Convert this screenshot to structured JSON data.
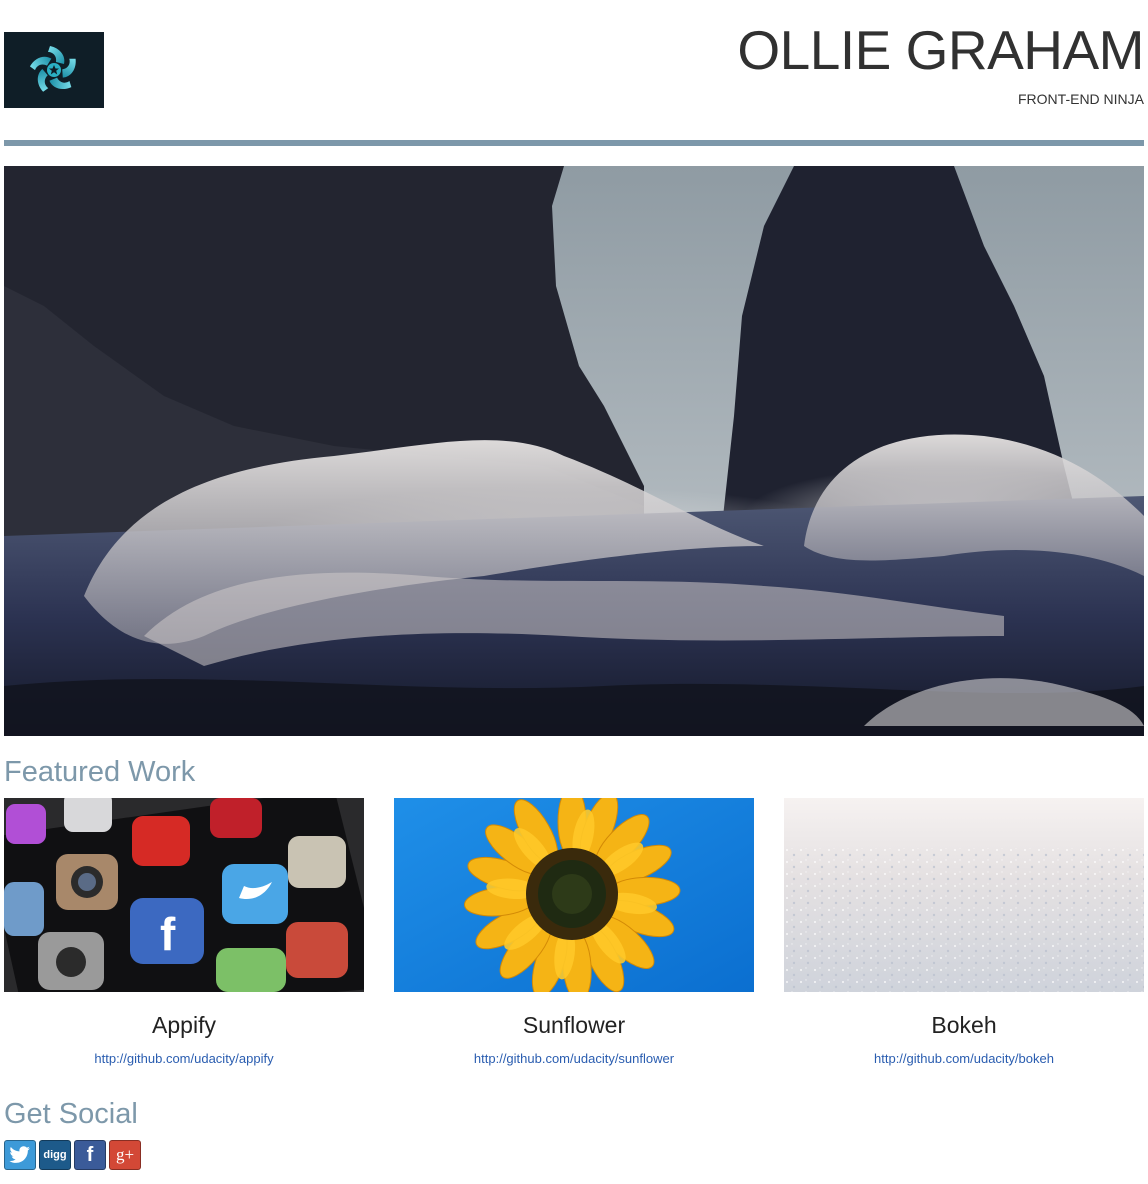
{
  "header": {
    "logo_icon": "star-knot-logo",
    "name": "OLLIE GRAHAM",
    "tagline": "FRONT-END NINJA"
  },
  "hero": {
    "image": "ocean-waves-sea-stacks"
  },
  "featured": {
    "title": "Featured Work",
    "projects": [
      {
        "title": "Appify",
        "link": "http://github.com/udacity/appify",
        "image": "smartphone-app-icons"
      },
      {
        "title": "Sunflower",
        "link": "http://github.com/udacity/sunflower",
        "image": "sunflower-blue-sky"
      },
      {
        "title": "Bokeh",
        "link": "http://github.com/udacity/bokeh",
        "image": "sparkling-snow"
      }
    ]
  },
  "social": {
    "title": "Get Social",
    "buttons": [
      {
        "icon": "twitter-icon",
        "color": "#3d9ad8"
      },
      {
        "icon": "digg-icon",
        "label": "digg",
        "color": "#1d5a8a"
      },
      {
        "icon": "facebook-icon",
        "label": "f",
        "color": "#3b5b99"
      },
      {
        "icon": "google-plus-icon",
        "label": "g+",
        "color": "#d34836"
      }
    ]
  },
  "colors": {
    "accent": "#7d98aa",
    "link": "#2a5db0",
    "logo_bg": "#0f1e27"
  }
}
